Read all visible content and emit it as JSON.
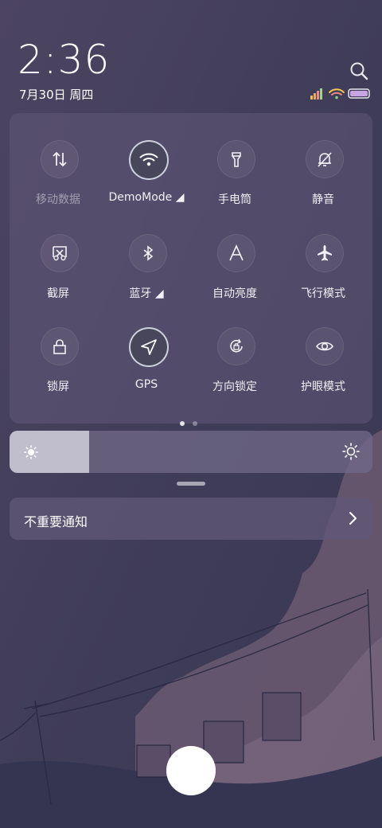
{
  "status": {
    "time": "2:36",
    "date": "7月30日 周四"
  },
  "icons": {
    "search": "search-icon",
    "signal": "signal-icon",
    "wifi": "wifi-icon",
    "battery": "battery-icon"
  },
  "quick_settings": {
    "tiles": [
      {
        "label": "移动数据",
        "icon": "mobile-data-icon",
        "active": false,
        "dim": true
      },
      {
        "label": "DemoMode ◢",
        "icon": "wifi-icon",
        "active": true,
        "dim": false
      },
      {
        "label": "手电筒",
        "icon": "flashlight-icon",
        "active": false,
        "dim": false
      },
      {
        "label": "静音",
        "icon": "mute-bell-icon",
        "active": false,
        "dim": false
      },
      {
        "label": "截屏",
        "icon": "screenshot-icon",
        "active": false,
        "dim": false
      },
      {
        "label": "蓝牙 ◢",
        "icon": "bluetooth-icon",
        "active": false,
        "dim": false
      },
      {
        "label": "自动亮度",
        "icon": "auto-brightness-icon",
        "active": false,
        "dim": false
      },
      {
        "label": "飞行模式",
        "icon": "airplane-icon",
        "active": false,
        "dim": false
      },
      {
        "label": "锁屏",
        "icon": "lock-icon",
        "active": false,
        "dim": false
      },
      {
        "label": "GPS",
        "icon": "gps-icon",
        "active": true,
        "dim": false
      },
      {
        "label": "方向锁定",
        "icon": "rotation-lock-icon",
        "active": false,
        "dim": false
      },
      {
        "label": "护眼模式",
        "icon": "eye-icon",
        "active": false,
        "dim": false
      }
    ],
    "page_count": 2,
    "current_page": 1
  },
  "brightness": {
    "level": 0.22
  },
  "notifications": {
    "unimportant_label": "不重要通知"
  },
  "colors": {
    "active_ring": "#dce1eb",
    "panel": "#605878"
  }
}
